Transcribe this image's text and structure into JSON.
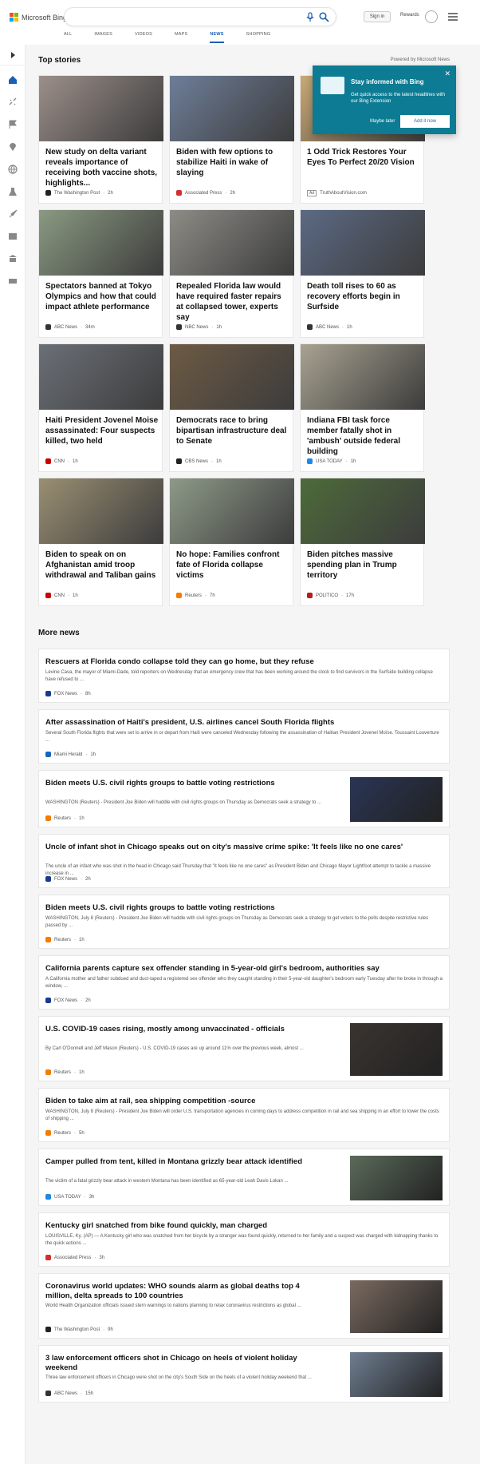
{
  "header": {
    "logo_text": "Microsoft Bing",
    "signin": "Sign in",
    "rewards": "Rewards"
  },
  "nav": [
    "ALL",
    "IMAGES",
    "VIDEOS",
    "MAPS",
    "NEWS",
    "SHOPPING"
  ],
  "top_stories": {
    "title": "Top stories",
    "powered": "Powered by Microsoft News",
    "cards": [
      {
        "title": "New study on delta variant reveals importance of receiving both vaccine shots, highlights...",
        "source": "The Washington Post",
        "time": "2h",
        "img": "#9c8f8a"
      },
      {
        "title": "Biden with few options to stabilize Haiti in wake of slaying",
        "source": "Associated Press",
        "time": "2h",
        "img": "#6e7e99"
      },
      {
        "title": "1 Odd Trick Restores Your Eyes To Perfect 20/20 Vision",
        "source": "TruthAboutVision.com",
        "time": "",
        "ad": "Ad",
        "img": "#c9a874"
      },
      {
        "title": "Spectators banned at Tokyo Olympics and how that could impact athlete performance",
        "source": "ABC News",
        "time": "34m",
        "img": "#8a9a82"
      },
      {
        "title": "Repealed Florida law would have required faster repairs at collapsed tower, experts say",
        "source": "NBC News",
        "time": "1h",
        "img": "#8d8c86"
      },
      {
        "title": "Death toll rises to 60 as recovery efforts begin in Surfside",
        "source": "ABC News",
        "time": "1h",
        "img": "#5b6a84"
      },
      {
        "title": "Haiti President Jovenel Moise assassinated: Four suspects killed, two held",
        "source": "CNN",
        "time": "1h",
        "img": "#6b7077"
      },
      {
        "title": "Democrats race to bring bipartisan infrastructure deal to Senate",
        "source": "CBS News",
        "time": "1h",
        "img": "#6d5a44"
      },
      {
        "title": "Indiana FBI task force member fatally shot in 'ambush' outside federal building",
        "source": "USA TODAY",
        "time": "1h",
        "img": "#a8a290"
      },
      {
        "title": "Biden to speak on on Afghanistan amid troop withdrawal and Taliban gains",
        "source": "CNN",
        "time": "1h",
        "img": "#9a8f72"
      },
      {
        "title": "No hope: Families confront fate of Florida collapse victims",
        "source": "Reuters",
        "time": "7h",
        "img": "#8e9a88"
      },
      {
        "title": "Biden pitches massive spending plan in Trump territory",
        "source": "POLITICO",
        "time": "17h",
        "img": "#4d6b3a"
      }
    ]
  },
  "popup": {
    "title": "Stay informed with Bing",
    "desc": "Get quick access to the latest headlines with our Bing Extension",
    "later": "Maybe later",
    "add": "Add it now",
    "close": "✕"
  },
  "more_news": {
    "title": "More news",
    "items": [
      {
        "title": "Rescuers at Florida condo collapse told they can go home, but they refuse",
        "snippet": "Levine Cava, the mayor of Miami-Dade, told reporters on Wednesday that an emergency crew that has been working around the clock to find survivors in the Surfside building collapse have refused to ...",
        "source": "FOX News",
        "time": "8h"
      },
      {
        "title": "After assassination of Haiti's president, U.S. airlines cancel South Florida flights",
        "snippet": "Several South Florida flights that were set to arrive in or depart from Haiti were canceled Wednesday following the assassination of Haitian President Jovenel Moïse. Toussaint Louverture ...",
        "source": "Miami Herald",
        "time": "1h"
      },
      {
        "title": "Biden meets U.S. civil rights groups to battle voting restrictions",
        "snippet": "WASHINGTON (Reuters) - President Joe Biden will huddle with civil rights groups on Thursday as Democrats seek a strategy to ...",
        "source": "Reuters",
        "time": "1h",
        "thumb": "#2a3555"
      },
      {
        "title": "Uncle of infant shot in Chicago speaks out on city's massive crime spike: 'It feels like no one cares'",
        "snippet": "The uncle of an infant who was shot in the head in Chicago said Thursday that \"it feels like no one cares\" as President Biden and Chicago Mayor Lightfoot attempt to tackle a massive increase in ...",
        "source": "FOX News",
        "time": "2h"
      },
      {
        "title": "Biden meets U.S. civil rights groups to battle voting restrictions",
        "snippet": "WASHINGTON, July 8 (Reuters) - President Joe Biden will huddle with civil rights groups on Thursday as Democrats seek a strategy to get voters to the polls despite restrictive rules passed by ...",
        "source": "Reuters",
        "time": "1h"
      },
      {
        "title": "California parents capture sex offender standing in 5-year-old girl's bedroom, authorities say",
        "snippet": "A California mother and father subdued and duct-taped a registered sex offender who they caught standing in their 5-year-old daughter's bedroom early Tuesday after he broke in through a window, ...",
        "source": "FOX News",
        "time": "2h"
      },
      {
        "title": "U.S. COVID-19 cases rising, mostly among unvaccinated - officials",
        "snippet": "By Carl O'Donnell and Jeff Mason (Reuters) - U.S. COVID-19 cases are up around 11% over the previous week, almost ...",
        "source": "Reuters",
        "time": "1h",
        "thumb": "#3a3430"
      },
      {
        "title": "Biden to take aim at rail, sea shipping competition -source",
        "snippet": "WASHINGTON, July 8 (Reuters) - President Joe Biden will order U.S. transportation agencies in coming days to address competition in rail and sea shipping in an effort to lower the costs of shipping ...",
        "source": "Reuters",
        "time": "5h"
      },
      {
        "title": "Camper pulled from tent, killed in Montana grizzly bear attack identified",
        "snippet": "The victim of a fatal grizzly bear attack in western Montana has been identified as 65-year-old Leah Davis Lokan ...",
        "source": "USA TODAY",
        "time": "3h",
        "thumb": "#5a6b5a"
      },
      {
        "title": "Kentucky girl snatched from bike found quickly, man charged",
        "snippet": "LOUISVILLE, Ky. (AP) — A Kentucky girl who was snatched from her bicycle by a stranger was found quickly, returned to her family and a suspect was charged with kidnapping thanks to the quick actions ...",
        "source": "Associated Press",
        "time": "3h"
      },
      {
        "title": "Coronavirus world updates: WHO sounds alarm as global deaths top 4 million, delta spreads to 100 countries",
        "snippet": "World Health Organization officials issued stern warnings to nations planning to relax coronavirus restrictions as global ...",
        "source": "The Washington Post",
        "time": "9h",
        "thumb": "#7a6a60"
      },
      {
        "title": "3 law enforcement officers shot in Chicago on heels of violent holiday weekend",
        "snippet": "Three law enforcement officers in Chicago were shot on the city's South Side on the heels of a violent holiday weekend that ...",
        "source": "ABC News",
        "time": "15h",
        "thumb": "#6e7d90"
      }
    ]
  }
}
